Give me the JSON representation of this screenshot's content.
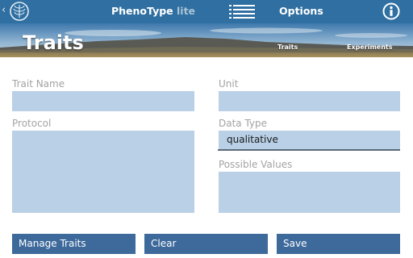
{
  "app": {
    "name": "PhenoType",
    "edition": "lite"
  },
  "header": {
    "options_label": "Options"
  },
  "page": {
    "title": "Traits"
  },
  "tabs": [
    {
      "label": "Traits"
    },
    {
      "label": "Experiments"
    }
  ],
  "form": {
    "trait_name": {
      "label": "Trait Name",
      "value": ""
    },
    "unit": {
      "label": "Unit",
      "value": ""
    },
    "protocol": {
      "label": "Protocol",
      "value": ""
    },
    "data_type": {
      "label": "Data Type",
      "value": "qualitative"
    },
    "possible_values": {
      "label": "Possible Values",
      "value": ""
    }
  },
  "buttons": {
    "manage_traits": "Manage Traits",
    "clear": "Clear",
    "save": "Save"
  },
  "colors": {
    "action_bar": "#2f6fa1",
    "field_fill": "#b9d0e6",
    "button_fill": "#3d6a9b",
    "label_text": "#a3a3a3"
  },
  "icons": [
    "back-chevron-icon",
    "app-logo-icon",
    "menu-list-icon",
    "info-icon"
  ]
}
